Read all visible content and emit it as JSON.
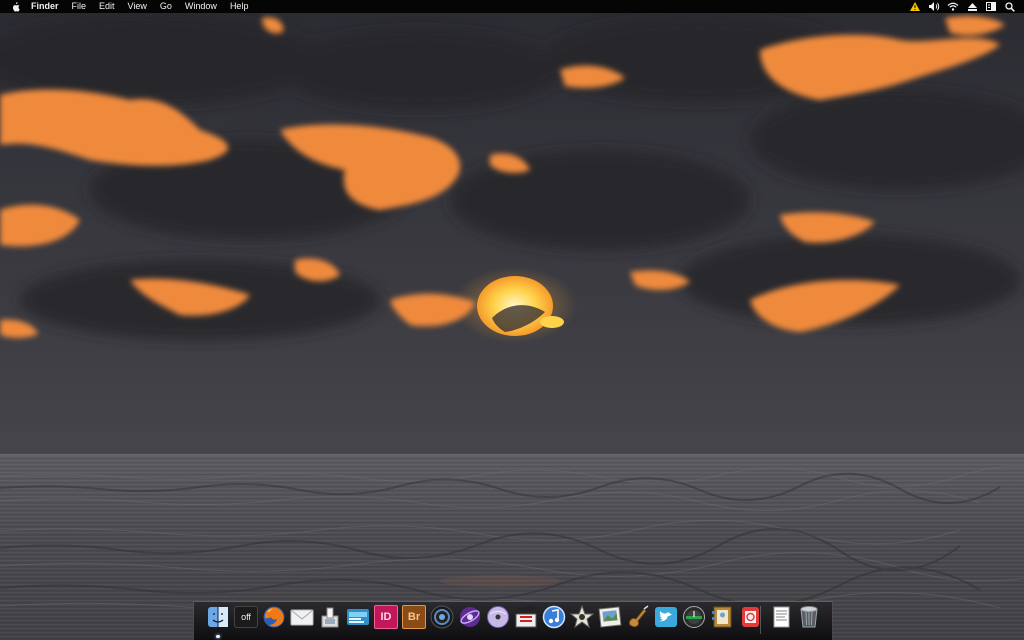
{
  "menubar": {
    "apple_icon": "apple-icon",
    "items": [
      {
        "label": "Finder",
        "bold": true
      },
      {
        "label": "File"
      },
      {
        "label": "Edit"
      },
      {
        "label": "View"
      },
      {
        "label": "Go"
      },
      {
        "label": "Window"
      },
      {
        "label": "Help"
      }
    ],
    "status_icons": [
      "warning-icon",
      "volume-icon",
      "wifi-icon",
      "eject-icon",
      "window-list-icon",
      "spotlight-search-icon"
    ]
  },
  "desktop": {
    "wallpaper": "sunset-over-sea-with-clouds",
    "colors": {
      "cloud_glow": "#f08a3c",
      "sun": "#ffd24a",
      "sky": "#33333a",
      "sea": "#4d4d53"
    }
  },
  "dock": {
    "apps": [
      {
        "icon": "finder-icon",
        "running": true
      },
      {
        "icon": "caffeine-off-icon",
        "text": "off"
      },
      {
        "icon": "firefox-icon"
      },
      {
        "icon": "mail-icon"
      },
      {
        "icon": "preview-icon"
      },
      {
        "icon": "dreamweaver-icon"
      },
      {
        "icon": "indesign-icon",
        "text": "ID"
      },
      {
        "icon": "bridge-icon",
        "text": "Br"
      },
      {
        "icon": "aperture-icon"
      },
      {
        "icon": "motion-icon"
      },
      {
        "icon": "dvd-studio-icon"
      },
      {
        "icon": "final-cut-icon"
      },
      {
        "icon": "itunes-icon"
      },
      {
        "icon": "imovie-icon"
      },
      {
        "icon": "iphoto-icon"
      },
      {
        "icon": "garageband-icon"
      },
      {
        "icon": "twitter-icon"
      },
      {
        "icon": "time-machine-icon"
      },
      {
        "icon": "address-book-icon"
      },
      {
        "icon": "news-reader-icon"
      }
    ],
    "trailing": [
      {
        "icon": "documents-stack-icon"
      },
      {
        "icon": "trash-icon"
      }
    ]
  }
}
